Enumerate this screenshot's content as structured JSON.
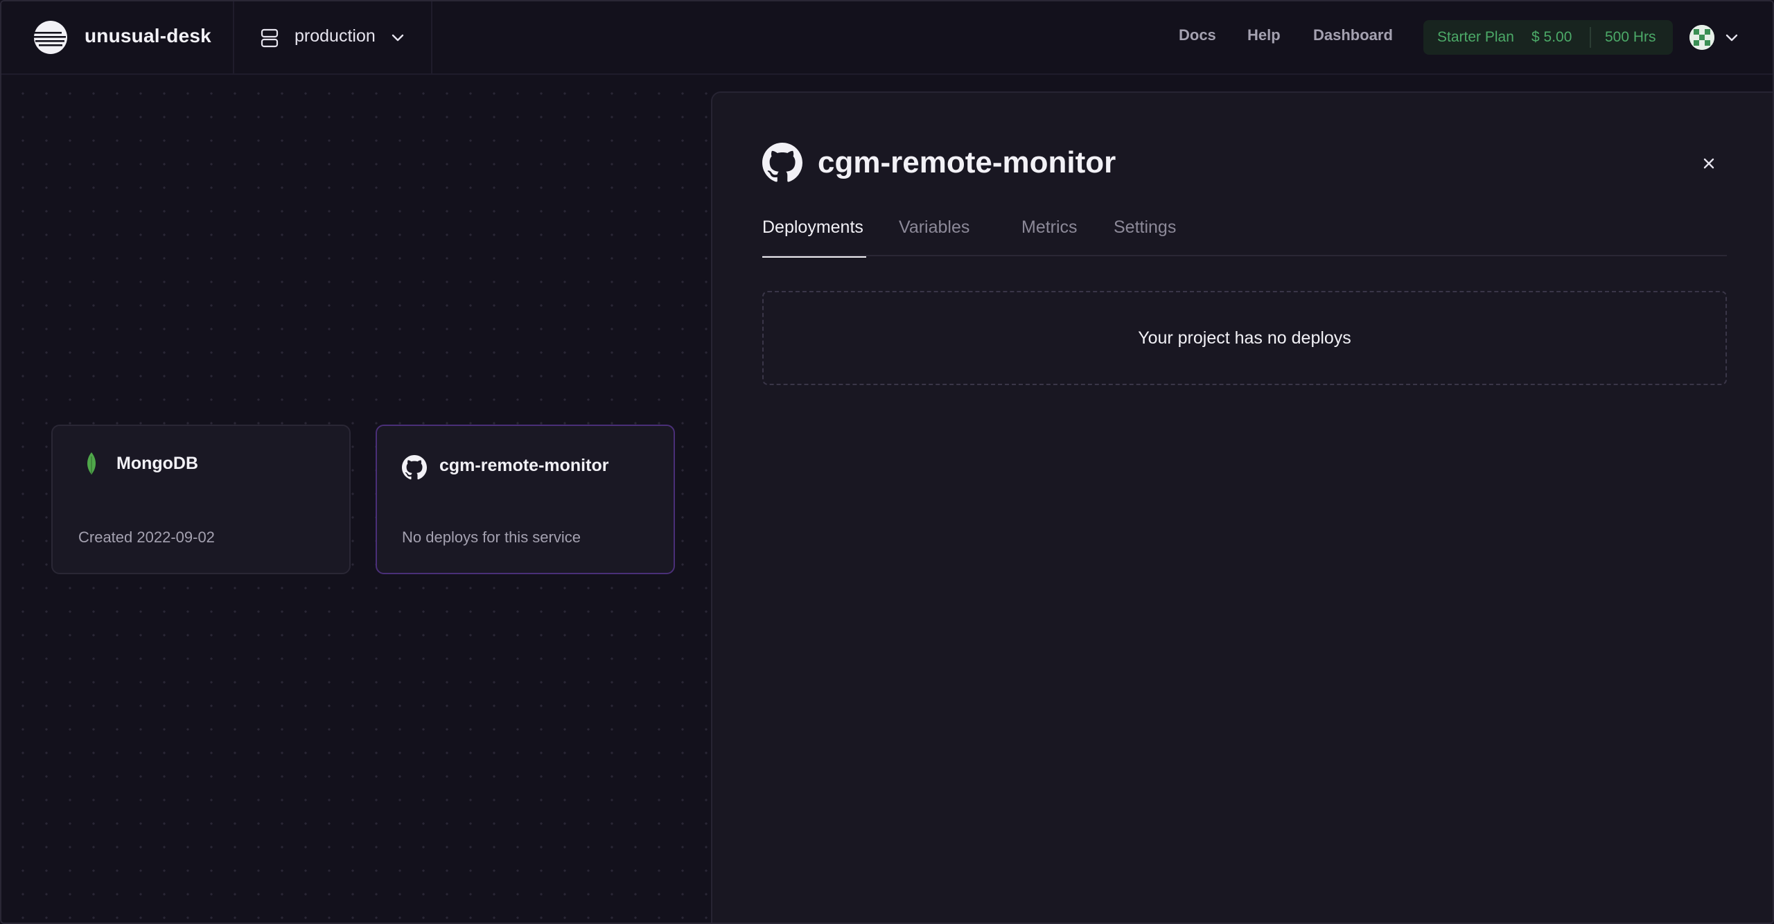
{
  "header": {
    "project_name": "unusual-desk",
    "environment": "production",
    "nav": {
      "docs": "Docs",
      "help": "Help",
      "dashboard": "Dashboard"
    },
    "plan": {
      "name": "Starter Plan",
      "price": "$ 5.00",
      "hours": "500 Hrs"
    }
  },
  "canvas": {
    "services": [
      {
        "name": "MongoDB",
        "subtitle": "Created 2022-09-02",
        "icon": "mongodb-leaf-icon"
      },
      {
        "name": "cgm-remote-monitor",
        "subtitle": "No deploys for this service",
        "icon": "github-icon"
      }
    ]
  },
  "panel": {
    "title": "cgm-remote-monitor",
    "tabs": [
      "Deployments",
      "Variables",
      "Metrics",
      "Settings"
    ],
    "active_tab": "Deployments",
    "empty_message": "Your project has no deploys"
  },
  "colors": {
    "background": "#13111c",
    "panel": "#191722",
    "accent_green": "#4caa68",
    "selected_border": "#4a2f78",
    "mongo_green": "#4fa74a"
  }
}
